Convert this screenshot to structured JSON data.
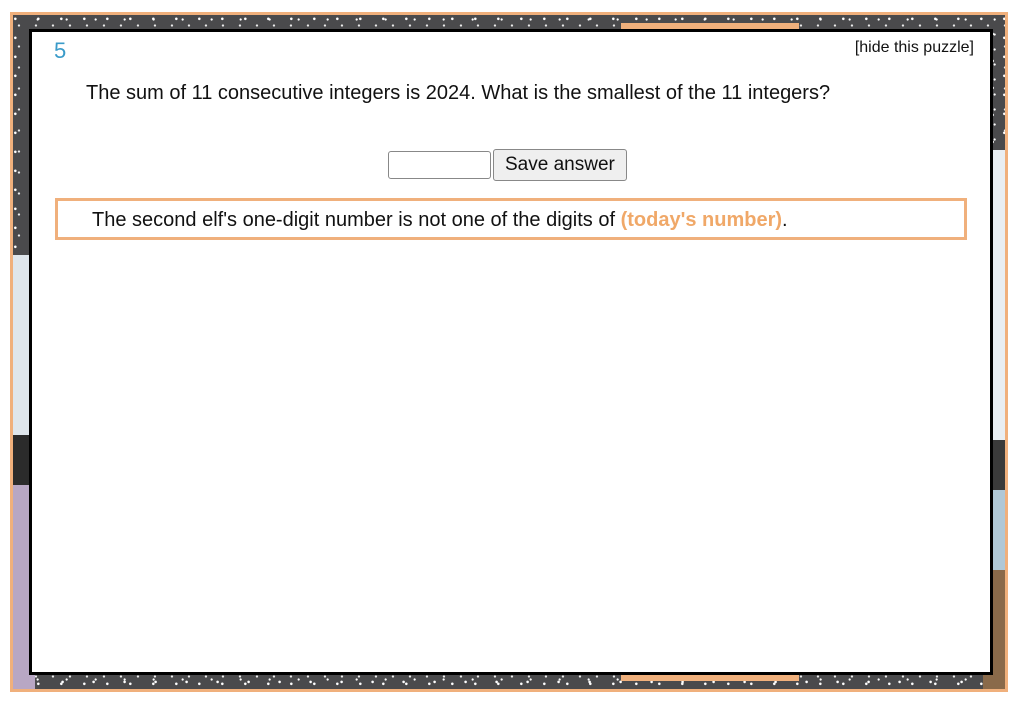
{
  "puzzle": {
    "number": "5",
    "hide_label": "[hide this puzzle]",
    "question": "The sum of 11 consecutive integers is 2024. What is the smallest of the 11 integers?",
    "answer_value": "",
    "save_label": "Save answer"
  },
  "clue": {
    "text_before": "The second elf's one-digit number is not one of the digits of ",
    "highlight": "(today's number)",
    "text_after": "."
  },
  "colors": {
    "accent_orange": "#f0b07c",
    "number_blue": "#3a9bc9"
  }
}
